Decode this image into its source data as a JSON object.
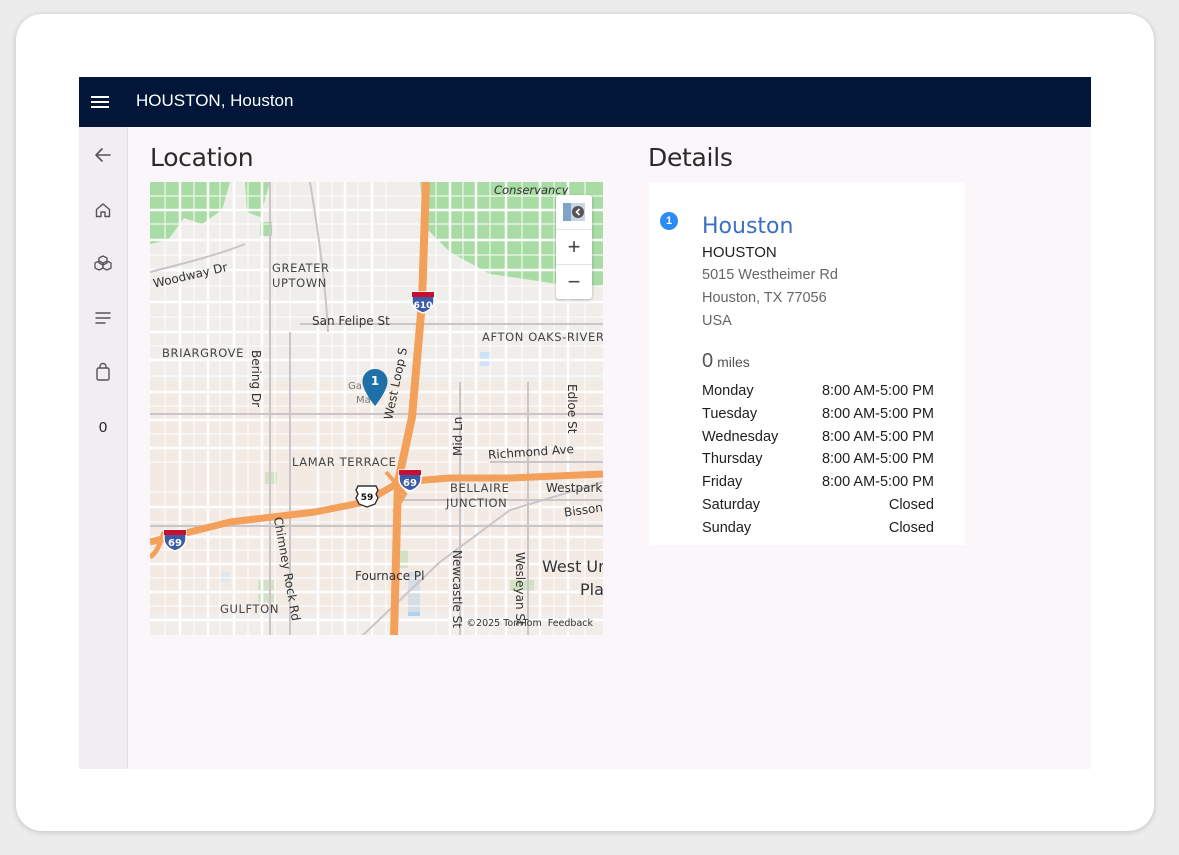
{
  "header": {
    "title": "HOUSTON, Houston"
  },
  "sidebar": {
    "items": [
      {
        "icon": "back-arrow-icon"
      },
      {
        "icon": "home-icon"
      },
      {
        "icon": "products-icon"
      },
      {
        "icon": "list-icon"
      },
      {
        "icon": "bag-icon"
      }
    ],
    "cart_count": "0"
  },
  "location": {
    "title": "Location"
  },
  "map": {
    "labels": {
      "conservancy": "Conservancy",
      "woodway": "Woodway Dr",
      "greater": "GREATER",
      "uptown": "UPTOWN",
      "san_felipe": "San Felipe St",
      "afton": "AFTON OAKS-RIVER",
      "briargrove": "BRIARGROVE",
      "bering": "Bering Dr",
      "west_loop": "West Loop S",
      "mid_ln": "Mid Ln",
      "edloe": "Edloe St",
      "richmond": "Richmond Ave",
      "lamar": "LAMAR TERRACE",
      "bellaire": "BELLAIRE",
      "junction": "JUNCTION",
      "westpark": "Westpark",
      "bissonnet": "Bisson",
      "chimney": "Chimney Rock Rd",
      "newcastle": "Newcastle St",
      "wesleyan": "Wesleyan St",
      "fournace": "Fournace Pl",
      "gulfton": "GULFTON",
      "west_u": "West Ur",
      "pla": "Pla",
      "galleria": "Ga",
      "mall": "Ma"
    },
    "shields": {
      "i610": "610",
      "i69a": "69",
      "i69b": "69",
      "us59": "59"
    },
    "pin_number": "1",
    "copyright": "©2025 TomTom",
    "feedback": "Feedback",
    "zoom_in": "+",
    "zoom_out": "−"
  },
  "details": {
    "title": "Details",
    "badge": "1",
    "store_name": "Houston",
    "store_code": "HOUSTON",
    "address": [
      "5015 Westheimer Rd",
      "Houston, TX 77056",
      "USA"
    ],
    "distance_value": "0",
    "distance_unit": "miles",
    "hours": [
      {
        "day": "Monday",
        "time": "8:00 AM-5:00 PM"
      },
      {
        "day": "Tuesday",
        "time": "8:00 AM-5:00 PM"
      },
      {
        "day": "Wednesday",
        "time": "8:00 AM-5:00 PM"
      },
      {
        "day": "Thursday",
        "time": "8:00 AM-5:00 PM"
      },
      {
        "day": "Friday",
        "time": "8:00 AM-5:00 PM"
      },
      {
        "day": "Saturday",
        "time": "Closed"
      },
      {
        "day": "Sunday",
        "time": "Closed"
      }
    ]
  },
  "colors": {
    "header_bg": "#011639",
    "link": "#3a70c4",
    "badge": "#2c8cf4",
    "pin": "#1f6fa8",
    "highway": "#f3a05a",
    "park": "#a8dca4"
  }
}
